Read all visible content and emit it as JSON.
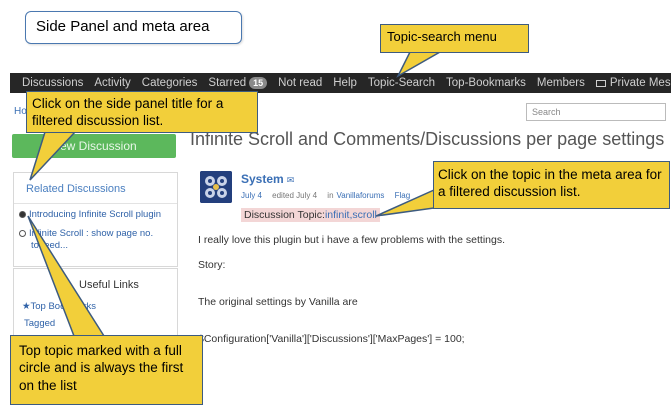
{
  "annotation_title": "Side Panel and meta area",
  "navbar": {
    "items": [
      "Discussions",
      "Activity",
      "Categories",
      "Starred",
      "Not read",
      "Help",
      "Topic-Search",
      "Top-Bookmarks",
      "Members",
      "Private Message"
    ],
    "starred_badge": "15"
  },
  "breadcrumb": {
    "home": "Ho"
  },
  "search": {
    "placeholder": "Search"
  },
  "new_discussion_label": "New Discussion",
  "page_title": "Infinite Scroll and Comments/Discussions per page settings",
  "side_panel": {
    "title": "Related Discussions",
    "items": [
      "Introducing Infinite Scroll plugin",
      "Infinite Scroll : show page no.",
      "totfeed..."
    ]
  },
  "useful_links": {
    "title": "Useful Links",
    "items": [
      "★Top Bookmarks",
      "Tagged"
    ]
  },
  "post": {
    "author": "System",
    "envelope": "✉",
    "date": "July 4",
    "edited": "edited July 4",
    "in_label": "in",
    "category": "Vanillaforums",
    "extra": "Flag",
    "topic_label": "Discussion Topic:",
    "topic_value": "infinit,scroll",
    "lines": [
      "I really love this plugin but i have a few problems with the settings.",
      "Story:",
      "The original settings by Vanilla are",
      "$Configuration['Vanilla']['Discussions']['MaxPages'] = 100;"
    ]
  },
  "callouts": {
    "topic_search_menu": "Topic-search menu",
    "side_panel_title": "Click on the side panel title for a filtered discussion list.",
    "meta_topic": "Click on the topic in the meta area for a filtered discussion list.",
    "top_topic": "Top topic marked with a full circle and is always the first on the list"
  },
  "colors": {
    "callout_fill": "#f2cf3a",
    "callout_border": "#3d5b80",
    "navbar_bg": "#262626",
    "button_green": "#5cb85c",
    "link_blue": "#3a6fb5"
  }
}
